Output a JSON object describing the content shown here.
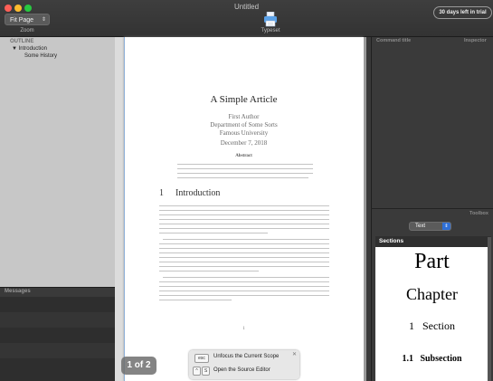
{
  "window": {
    "title": "Untitled"
  },
  "toolbar": {
    "zoom_value": "Fit Page",
    "zoom_label": "Zoom",
    "typeset_label": "Typeset",
    "trial_badge": "30 days left in trial"
  },
  "sidebar": {
    "outline_label": "OUTLINE",
    "items": [
      {
        "label": "Introduction"
      },
      {
        "label": "Some History"
      }
    ],
    "messages_label": "Messages"
  },
  "document": {
    "title": "A Simple Article",
    "author": "First Author",
    "department": "Department of Some Sorts",
    "university": "Famous University",
    "date": "December 7, 2018",
    "abstract_heading": "Abstract",
    "section_number": "1",
    "section_title": "Introduction",
    "page_number": "1"
  },
  "page_indicator": "1 of 2",
  "shortcuts": [
    {
      "keys": [
        "esc"
      ],
      "label": "Unfocus the Current Scope"
    },
    {
      "keys": [
        "^",
        "S"
      ],
      "label": "Open the Source Editor"
    }
  ],
  "right_pane": {
    "command_title_label": "Command title",
    "inspector_label": "Inspector",
    "toolbox_label": "Toolbox",
    "text_select_value": "Text",
    "sections_label": "Sections",
    "sections": [
      {
        "label": "Part"
      },
      {
        "label": "Chapter"
      },
      {
        "label": "1   Section"
      },
      {
        "label": "1.1   Subsection"
      }
    ]
  },
  "colors": {
    "close": "#ff5f57",
    "minimize": "#febc2e",
    "maximize": "#28c840",
    "accent": "#2f6fd6"
  }
}
